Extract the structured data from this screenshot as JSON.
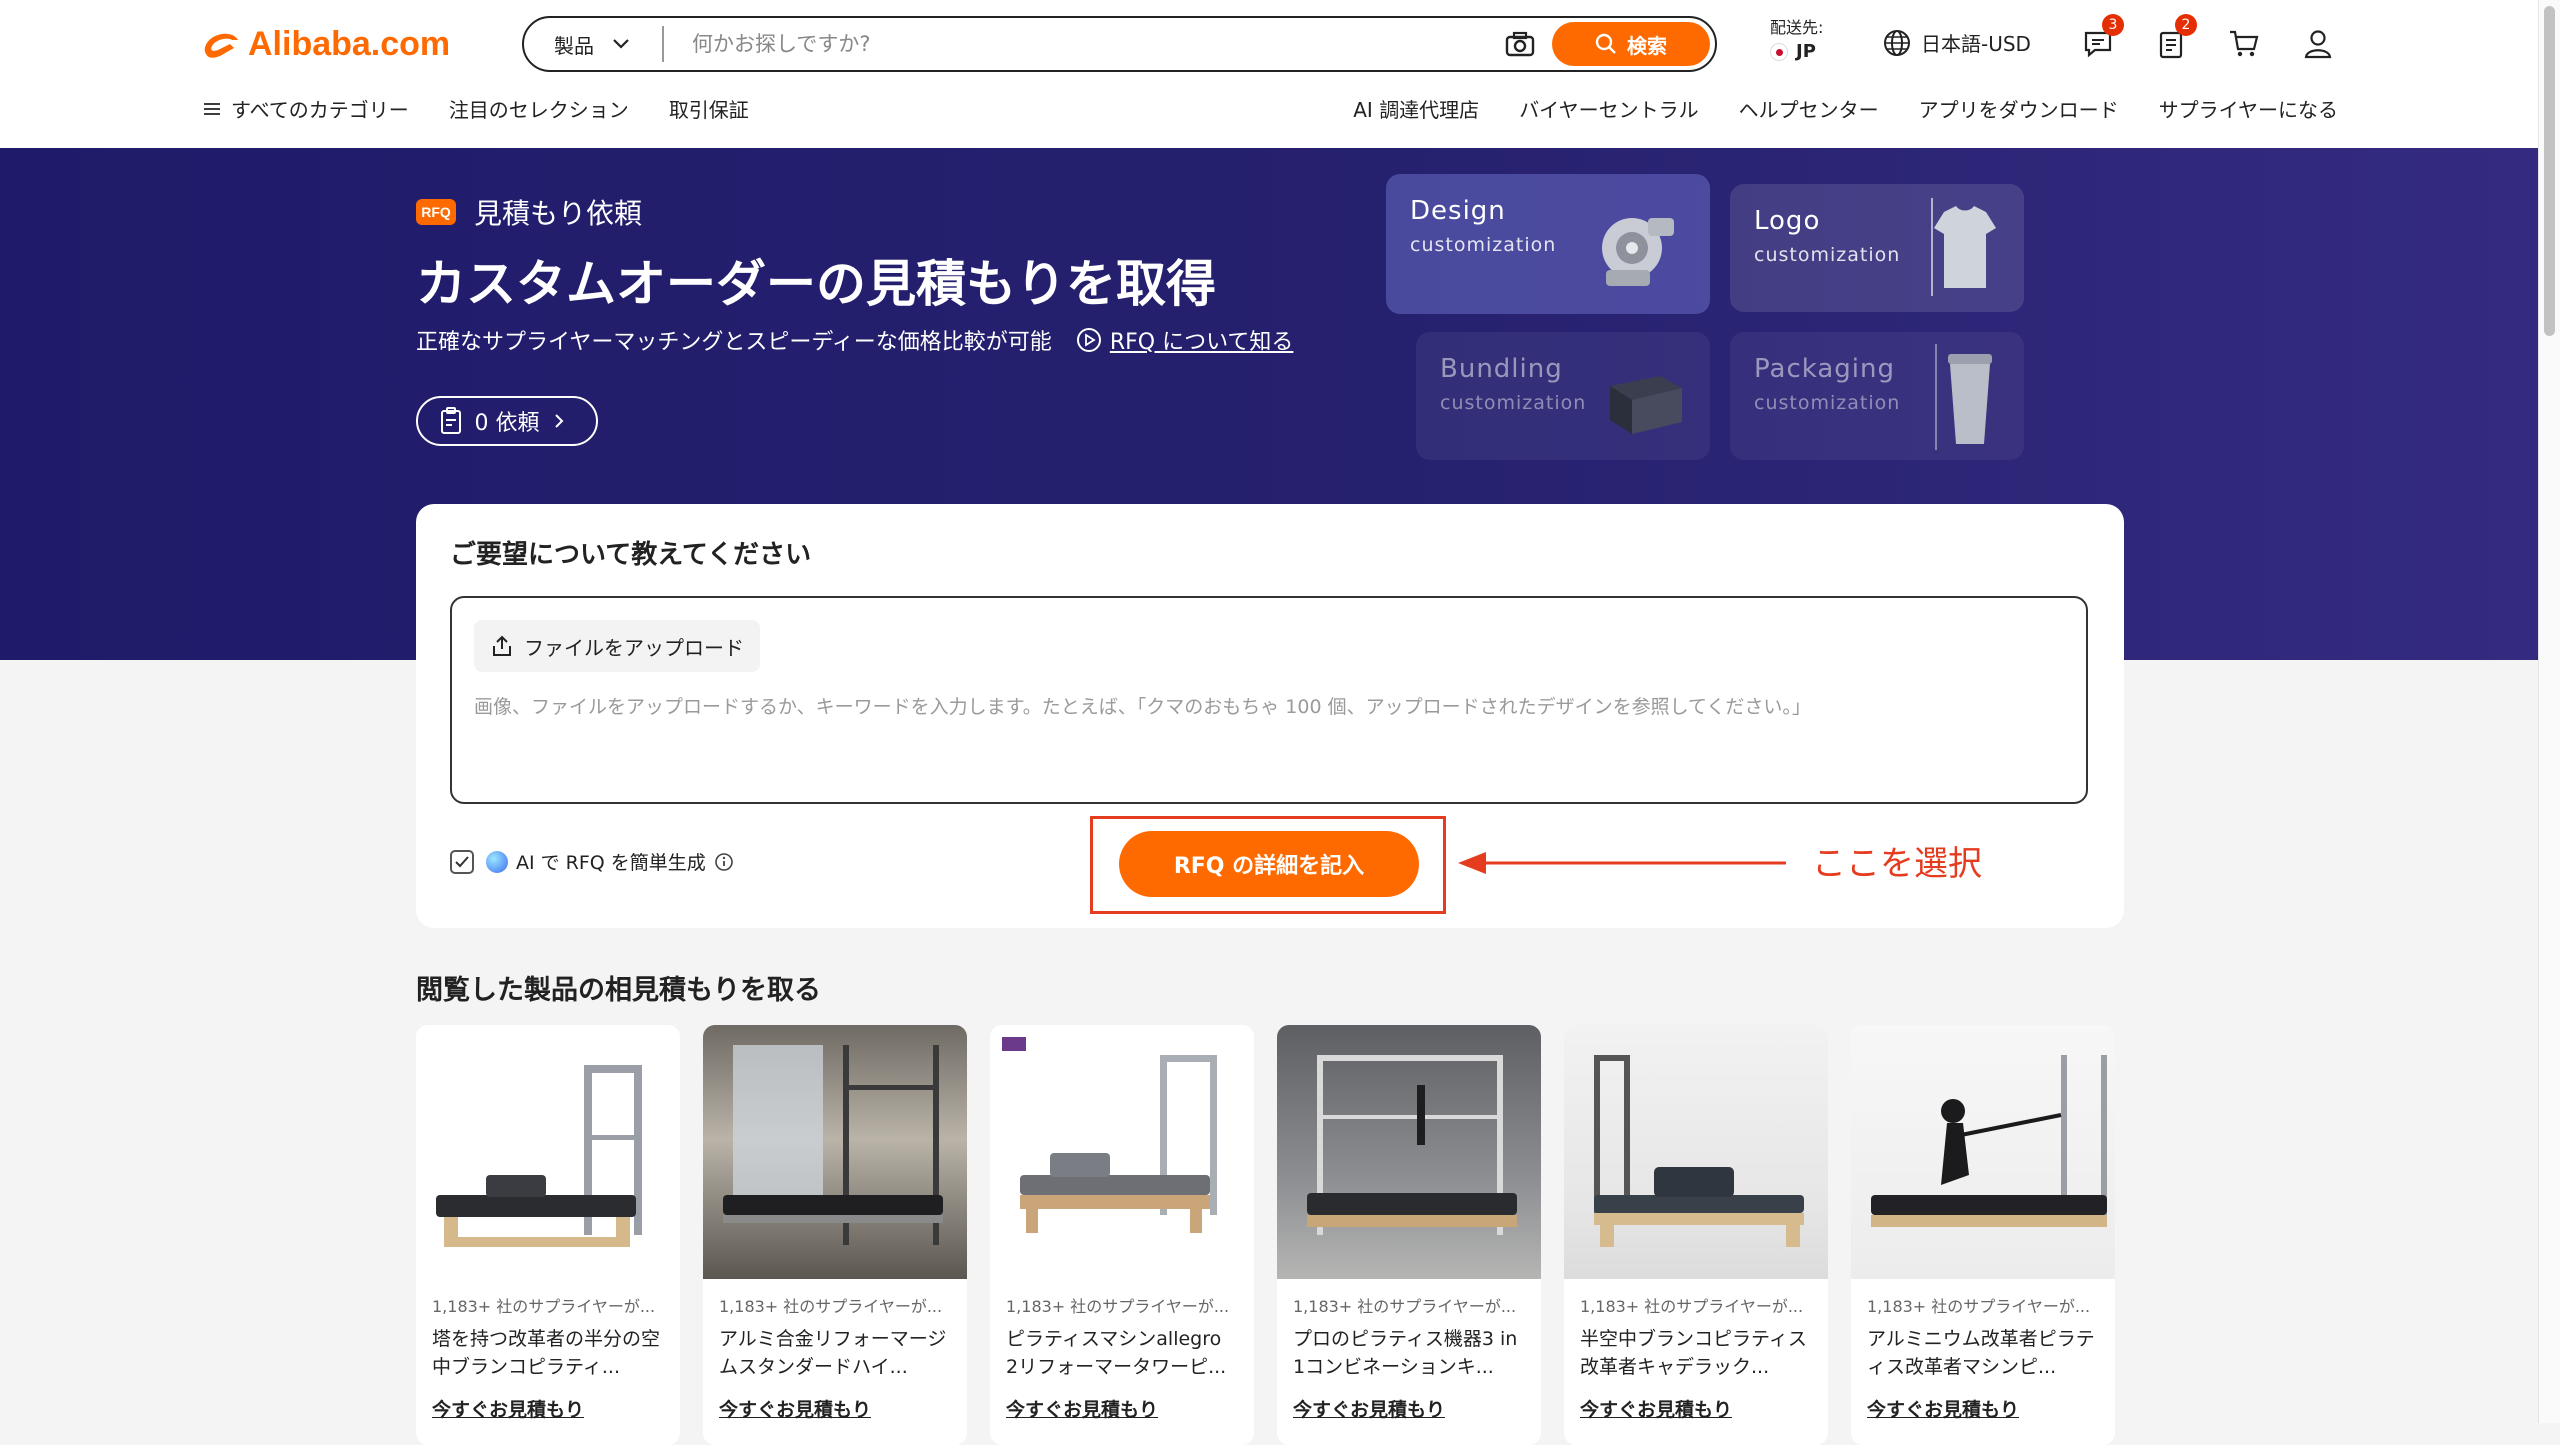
{
  "header": {
    "logo_text": "Alibaba.com",
    "search": {
      "category": "製品",
      "placeholder": "何かお探しですか?",
      "button": "検索"
    },
    "ship_to_label": "配送先:",
    "ship_to_country": "JP",
    "language": "日本語-USD",
    "messages_badge": "3",
    "orders_badge": "2",
    "accent_color": "#ff6a00"
  },
  "nav": {
    "left": [
      "すべてのカテゴリー",
      "注目のセレクション",
      "取引保証"
    ],
    "right": [
      "AI 調達代理店",
      "バイヤーセントラル",
      "ヘルプセンター",
      "アプリをダウンロード",
      "サプライヤーになる"
    ]
  },
  "banner": {
    "tag_logo": "RFQ",
    "tag": "見積もり依頼",
    "title": "カスタムオーダーの見積もりを取得",
    "subtitle": "正確なサプライヤーマッチングとスピーディーな価格比較が可能",
    "learn_link": "RFQ について知る",
    "requests_button": "0 依頼",
    "tiles": [
      {
        "title": "Design",
        "sub": "customization"
      },
      {
        "title": "Logo",
        "sub": "customization"
      },
      {
        "title": "Bundling",
        "sub": "customization"
      },
      {
        "title": "Packaging",
        "sub": "customization"
      }
    ]
  },
  "request_card": {
    "title": "ご要望について教えてください",
    "upload_button": "ファイルをアップロード",
    "placeholder": "画像、ファイルをアップロードするか、キーワードを入力します。たとえば、「クマのおもちゃ 100 個、アップロードされたデザインを参照してください。」",
    "ai_toggle_label": "AI で RFQ を簡単生成",
    "ai_toggle_checked": true,
    "submit_button": "RFQ の詳細を記入"
  },
  "annotation": {
    "text": "ここを選択",
    "color": "#e53b1f"
  },
  "products_section": {
    "title": "閲覧した製品の相見積もりを取る",
    "items": [
      {
        "supplier": "1,183+ 社のサプライヤーが...",
        "name": "塔を持つ改革者の半分の空中ブランコピラティ...",
        "action": "今すぐお見積もり"
      },
      {
        "supplier": "1,183+ 社のサプライヤーが...",
        "name": "アルミ合金リフォーマージムスタンダードハイ...",
        "action": "今すぐお見積もり"
      },
      {
        "supplier": "1,183+ 社のサプライヤーが...",
        "name": "ピラティスマシンallegro 2リフォーマータワーピ...",
        "action": "今すぐお見積もり"
      },
      {
        "supplier": "1,183+ 社のサプライヤーが...",
        "name": "プロのピラティス機器3 in 1コンビネーションキ...",
        "action": "今すぐお見積もり"
      },
      {
        "supplier": "1,183+ 社のサプライヤーが...",
        "name": "半空中ブランコピラティス改革者キャデラック...",
        "action": "今すぐお見積もり"
      },
      {
        "supplier": "1,183+ 社のサプライヤーが...",
        "name": "アルミニウム改革者ピラティス改革者マシンピ...",
        "action": "今すぐお見積もり"
      }
    ]
  }
}
